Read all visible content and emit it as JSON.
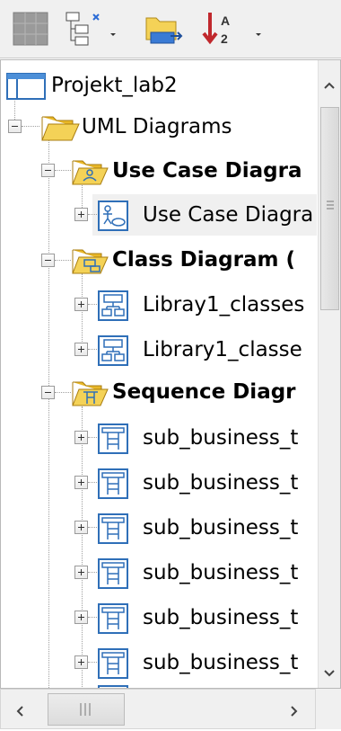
{
  "toolbar": {
    "icons": [
      "grid-icon",
      "tree-view-icon",
      "folder-move-icon",
      "sort-icon"
    ]
  },
  "tree": {
    "root": "Projekt_lab2",
    "uml_diagrams": "UML Diagrams",
    "use_case_group": "Use Case Diagra",
    "use_case_item": "Use Case Diagra",
    "class_group": "Class Diagram (",
    "class_items": [
      "Libray1_classes",
      "Library1_classe"
    ],
    "sequence_group": "Sequence Diagr",
    "sequence_items": [
      "sub_business_t",
      "sub_business_t",
      "sub_business_t",
      "sub_business_t",
      "sub_business_t",
      "sub_business_t"
    ]
  },
  "colors": {
    "folder_yellow": "#f2cc2e",
    "diagram_blue": "#2f6fb8",
    "selection": "#f0f0f0"
  }
}
